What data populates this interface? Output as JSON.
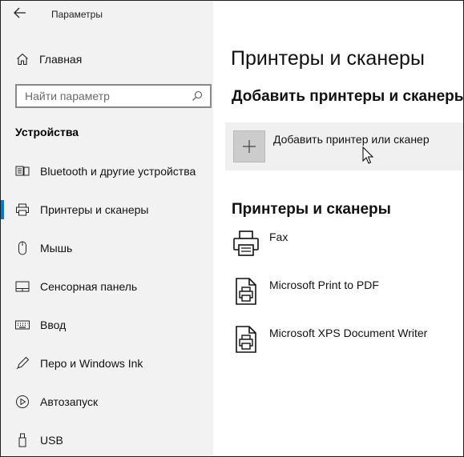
{
  "app": {
    "title": "Параметры"
  },
  "sidebar": {
    "home_label": "Главная",
    "search": {
      "placeholder": "Найти параметр",
      "value": ""
    },
    "section_title": "Устройства",
    "items": [
      {
        "label": "Bluetooth и другие устройства",
        "icon": "bluetooth-devices-icon",
        "active": false
      },
      {
        "label": "Принтеры и сканеры",
        "icon": "printer-icon",
        "active": true
      },
      {
        "label": "Мышь",
        "icon": "mouse-icon",
        "active": false
      },
      {
        "label": "Сенсорная панель",
        "icon": "touchpad-icon",
        "active": false
      },
      {
        "label": "Ввод",
        "icon": "keyboard-icon",
        "active": false
      },
      {
        "label": "Перо и Windows Ink",
        "icon": "pen-icon",
        "active": false
      },
      {
        "label": "Автозапуск",
        "icon": "autoplay-icon",
        "active": false
      },
      {
        "label": "USB",
        "icon": "usb-icon",
        "active": false
      }
    ]
  },
  "main": {
    "page_title": "Принтеры и сканеры",
    "add_heading": "Добавить принтеры и сканеры",
    "add_button_label": "Добавить принтер или сканер",
    "printers_heading": "Принтеры и сканеры",
    "printers": [
      {
        "name": "Fax",
        "icon": "fax-printer-icon"
      },
      {
        "name": "Microsoft Print to PDF",
        "icon": "document-printer-icon"
      },
      {
        "name": "Microsoft XPS Document Writer",
        "icon": "document-printer-icon"
      }
    ]
  },
  "colors": {
    "accent": "#0078d7",
    "sidebar_bg": "#f2f2f2",
    "tile_bg": "#f0f0f0"
  }
}
